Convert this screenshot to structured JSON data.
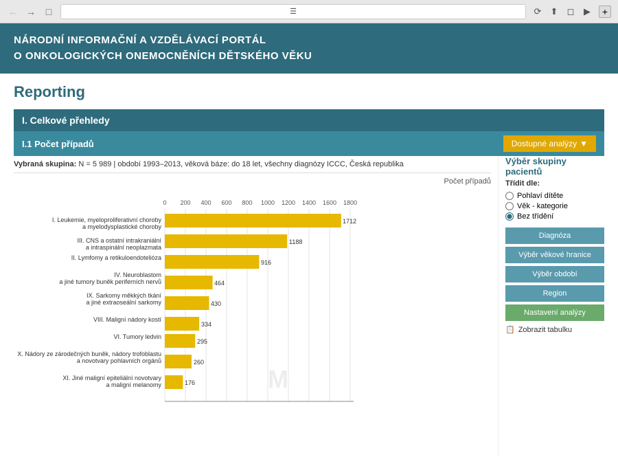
{
  "browser": {
    "address": "≡",
    "new_tab": "+"
  },
  "header": {
    "title_line1": "NÁRODNÍ INFORMAČNÍ A VZDĚLÁVACÍ PORTÁL",
    "title_line2": "O ONKOLOGICKÝCH ONEMOCNĚNÍCH DĚTSKÉHO VĚKU"
  },
  "page_title": "Reporting",
  "section": {
    "header": "I. Celkové přehledy",
    "subheader": "I.1 Počet případů",
    "dostupne_label": "Dostupné analýzy"
  },
  "info_bar": {
    "text": "Vybraná skupina: N = 5 989 | období 1993–2013, věková báze: do 18 let, všechny diagnózy ICCC, Česká republika"
  },
  "chart": {
    "x_label": "Počet případů",
    "bars": [
      {
        "label1": "I. Leukemie, myeloproliferativní choroby",
        "label2": "a myelodysplastické choroby",
        "value": 1712,
        "max": 1800
      },
      {
        "label1": "III. CNS a ostatní intrakraniální",
        "label2": "a intraspinální neoplazmata",
        "value": 1188,
        "max": 1800
      },
      {
        "label1": "II. Lymfomy a retikuloendotelióza",
        "label2": "",
        "value": 916,
        "max": 1800
      },
      {
        "label1": "IV. Neuroblastom",
        "label2": "a jiné tumory buněk periferních nervů",
        "value": 464,
        "max": 1800
      },
      {
        "label1": "IX. Sarkomy měkkých tkání",
        "label2": "a jiné extraoseální sarkomy",
        "value": 430,
        "max": 1800
      },
      {
        "label1": "VIII. Maligní nádory kostí",
        "label2": "",
        "value": 334,
        "max": 1800
      },
      {
        "label1": "VI. Tumory ledvin",
        "label2": "",
        "value": 295,
        "max": 1800
      },
      {
        "label1": "X. Nádory ze zárodečných buněk, nádory trofoblastu",
        "label2": "a novotvary pohlavních orgánů",
        "value": 260,
        "max": 1800
      },
      {
        "label1": "XI. Jiné maligní epiteliální novotvary",
        "label2": "a maligní melanomy",
        "value": 176,
        "max": 1800
      }
    ],
    "x_ticks": [
      0,
      200,
      400,
      600,
      800,
      1000,
      1200,
      1400,
      1600,
      1800
    ]
  },
  "sidebar": {
    "title": "Výběr skupiny pacientů",
    "sort_label": "Třídit dle:",
    "sort_options": [
      {
        "label": "Pohlaví dítěte",
        "value": "pohlavie",
        "checked": false
      },
      {
        "label": "Věk - kategorie",
        "value": "vek",
        "checked": false
      },
      {
        "label": "Bez třídění",
        "value": "bez",
        "checked": true
      }
    ],
    "buttons": [
      {
        "label": "Diagnóza",
        "name": "diagnoza-button"
      },
      {
        "label": "Výběr věkové hranice",
        "name": "vek-hranice-button"
      },
      {
        "label": "Výběr období",
        "name": "obdobi-button"
      },
      {
        "label": "Region",
        "name": "region-button"
      },
      {
        "label": "Nastavení analýzy",
        "name": "nastaveni-analyzy-button"
      }
    ],
    "table_label": "Zobrazit tabulku"
  }
}
